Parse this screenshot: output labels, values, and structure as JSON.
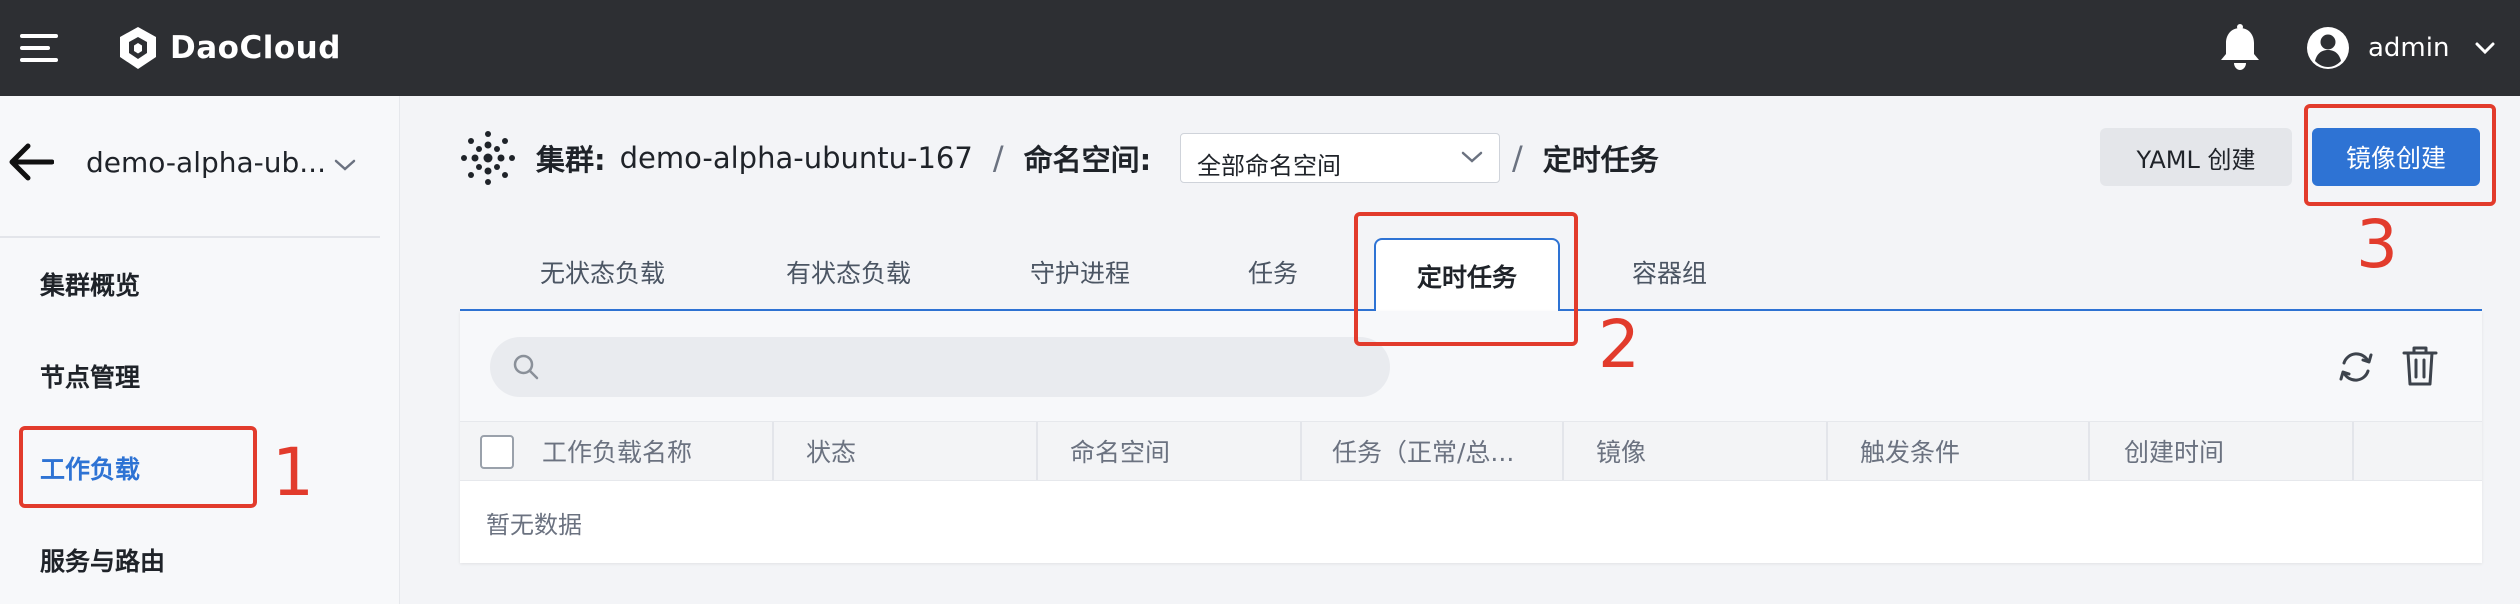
{
  "topbar": {
    "logo_text": "DaoCloud",
    "user_name": "admin"
  },
  "sidebar": {
    "cluster_name": "demo-alpha-ub...",
    "items": [
      {
        "label": "集群概览"
      },
      {
        "label": "节点管理"
      },
      {
        "label": "工作负载"
      },
      {
        "label": "服务与路由"
      }
    ]
  },
  "breadcrumb": {
    "cluster_label": "集群:",
    "cluster_value": "demo-alpha-ubuntu-167",
    "namespace_label": "命名空间:",
    "namespace_value": "全部命名空间",
    "separator": "/",
    "page_title": "定时任务"
  },
  "actions": {
    "yaml_create": "YAML 创建",
    "image_create": "镜像创建"
  },
  "tabs": [
    {
      "label": "无状态负载"
    },
    {
      "label": "有状态负载"
    },
    {
      "label": "守护进程"
    },
    {
      "label": "任务"
    },
    {
      "label": "定时任务"
    },
    {
      "label": "容器组"
    }
  ],
  "table": {
    "search_placeholder": "",
    "columns": [
      "工作负载名称",
      "状态",
      "命名空间",
      "任务（正常/总...",
      "镜像",
      "触发条件",
      "创建时间"
    ],
    "empty_text": "暂无数据"
  },
  "annotations": [
    "1",
    "2",
    "3"
  ],
  "colors": {
    "primary": "#2e73d4",
    "annotation": "#e23b2c",
    "topbar": "#2d2f33"
  }
}
